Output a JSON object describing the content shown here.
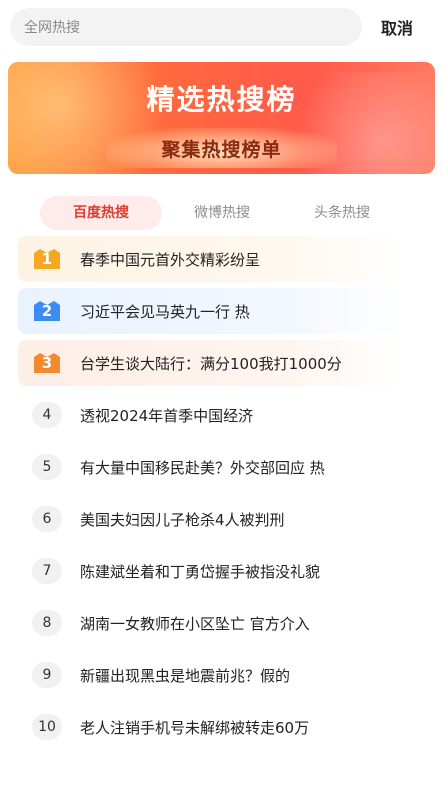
{
  "search": {
    "placeholder": "全网热搜",
    "cancel_label": "取消"
  },
  "banner": {
    "title": "精选热搜榜",
    "subtitle": "聚集热搜榜单"
  },
  "tabs": [
    {
      "label": "百度热搜",
      "active": true
    },
    {
      "label": "微博热搜",
      "active": false
    },
    {
      "label": "头条热搜",
      "active": false
    }
  ],
  "items": [
    {
      "rank": "1",
      "text": "春季中国元首外交精彩纷呈"
    },
    {
      "rank": "2",
      "text": "习近平会见马英九一行  热"
    },
    {
      "rank": "3",
      "text": "台学生谈大陆行：满分100我打1000分"
    },
    {
      "rank": "4",
      "text": "透视2024年首季中国经济"
    },
    {
      "rank": "5",
      "text": "有大量中国移民赴美？外交部回应  热"
    },
    {
      "rank": "6",
      "text": "美国夫妇因儿子枪杀4人被判刑"
    },
    {
      "rank": "7",
      "text": "陈建斌坐着和丁勇岱握手被指没礼貌"
    },
    {
      "rank": "8",
      "text": "湖南一女教师在小区坠亡 官方介入"
    },
    {
      "rank": "9",
      "text": "新疆出现黑虫是地震前兆？假的"
    },
    {
      "rank": "10",
      "text": "老人注销手机号未解绑被转走60万"
    }
  ],
  "colors": {
    "accent": "#e23b2c",
    "rank1": "#f5a623",
    "rank2": "#3b8cf5",
    "rank3": "#f28a2e"
  }
}
